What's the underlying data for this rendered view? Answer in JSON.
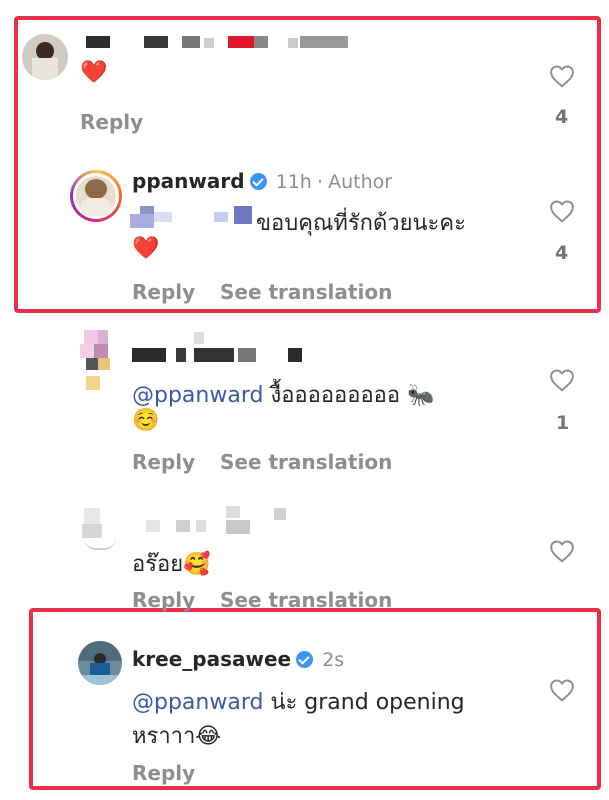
{
  "comments": [
    {
      "username": "",
      "text": "",
      "emoji": "❤️",
      "reply_label": "Reply",
      "like_count": "4"
    },
    {
      "username": "ppanward",
      "verified": true,
      "time": "11h",
      "badge": "Author",
      "separator": "·",
      "text": "ขอบคุณที่รักด้วยนะคะ",
      "emoji": "❤️",
      "reply_label": "Reply",
      "translate_label": "See translation",
      "like_count": "4"
    },
    {
      "username": "",
      "mention": "@ppanward",
      "text": "งื้อออออออออ",
      "emoji": "🐜",
      "emoji2": "☺️",
      "reply_label": "Reply",
      "translate_label": "See translation",
      "like_count": "1"
    },
    {
      "username": "",
      "text": "อร๊อย",
      "emoji": "🥰",
      "reply_label": "Reply",
      "translate_label": "See translation"
    },
    {
      "username": "kree_pasawee",
      "verified": true,
      "time": "2s",
      "mention": "@ppanward",
      "text": "น่ะ grand opening",
      "text2": "หราาา",
      "emoji": "😂",
      "reply_label": "Reply"
    }
  ],
  "colors": {
    "highlight": "#e8304b",
    "mention": "#3b5aa3",
    "verified": "#3897f0",
    "secondary_text": "#8e8e8e"
  }
}
